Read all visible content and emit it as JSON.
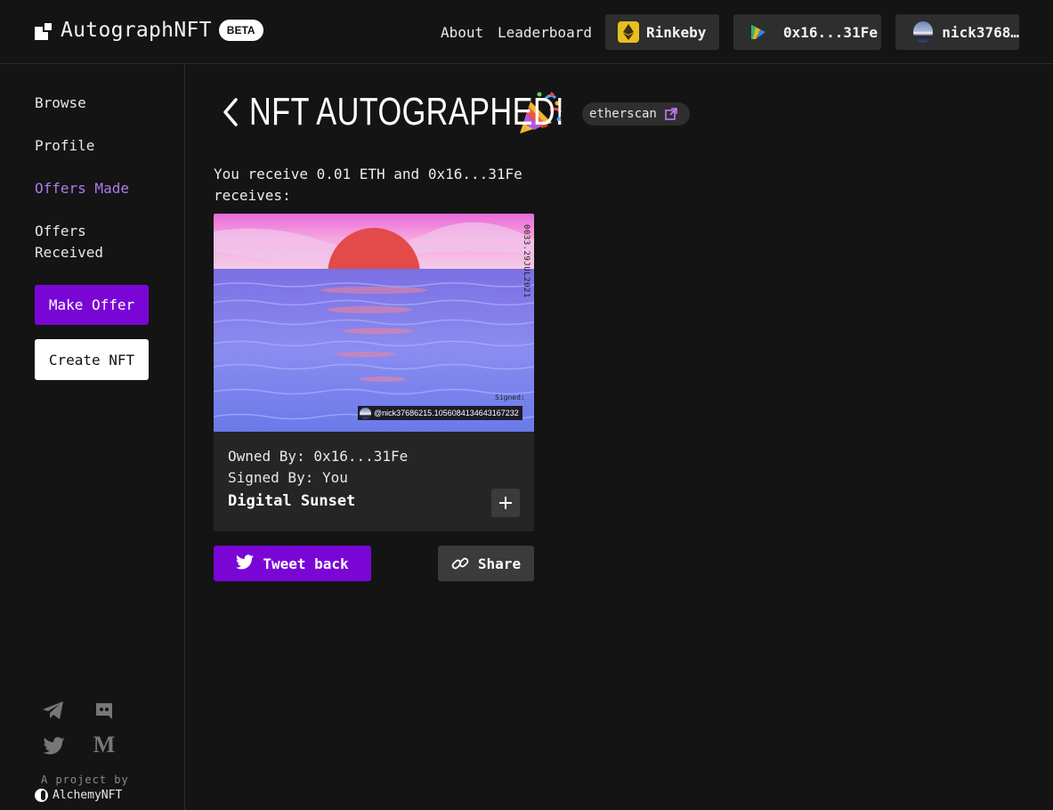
{
  "header": {
    "logo_text": "AutographNFT",
    "beta_badge": "BETA",
    "nav": {
      "about": "About",
      "leaderboard": "Leaderboard"
    },
    "network": "Rinkeby",
    "wallet_address": "0x16...31Fe",
    "username": "nick3768…"
  },
  "sidebar": {
    "items": [
      {
        "label": "Browse"
      },
      {
        "label": "Profile"
      },
      {
        "label": "Offers Made",
        "active": true
      },
      {
        "label": "Offers\nReceived"
      }
    ],
    "make_offer": "Make Offer",
    "create_nft": "Create NFT",
    "socials": [
      "telegram-icon",
      "discord-icon",
      "twitter-icon",
      "medium-icon"
    ],
    "project_by": "A project by",
    "alchemy": "AlchemyNFT"
  },
  "main": {
    "title": "NFT AUTOGRAPHED!",
    "etherscan": "etherscan",
    "receive_text": "You receive 0.01 ETH and 0x16...31Fe receives:",
    "nft": {
      "date_stamp": "0033.29JUL2021",
      "signed_label": "Signed:",
      "signature": "@nick37686215.1056084134643167232",
      "owned_by": "Owned By: 0x16...31Fe",
      "signed_by": "Signed By: You",
      "name": "Digital Sunset"
    },
    "tweet_back": "Tweet back",
    "share": "Share"
  },
  "colors": {
    "accent": "#7a06d6",
    "active_link": "#b07ae8",
    "background": "#141414"
  }
}
